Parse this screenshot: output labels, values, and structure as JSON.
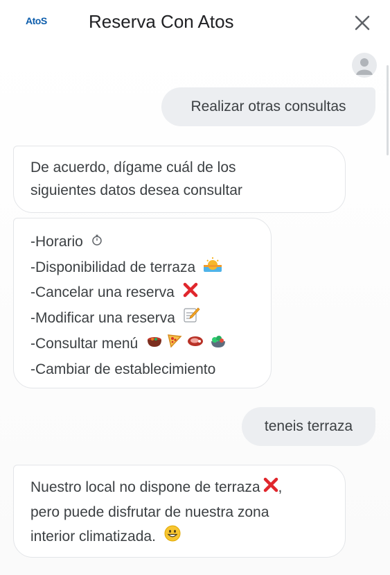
{
  "header": {
    "logo_text": "AtoS",
    "title": "Reserva Con Atos",
    "close_icon": "close-icon"
  },
  "chat": {
    "messages": [
      {
        "from": "user",
        "text": "Realizar otras consultas"
      },
      {
        "from": "bot",
        "lines": [
          "De acuerdo, dígame cuál de los",
          "siguientes datos desea consultar"
        ]
      },
      {
        "from": "bot",
        "lines": [
          "-Horario",
          "-Disponibilidad de terraza",
          "-Cancelar una reserva",
          "-Modificar una reserva",
          "-Consultar menú",
          "-Cambiar de establecimiento"
        ],
        "icons": [
          "stopwatch-icon",
          "sunrise-icon",
          "cross-mark-icon",
          "memo-icon",
          [
            "pot-of-food-icon",
            "pizza-icon",
            "meat-icon",
            "salad-icon"
          ]
        ]
      },
      {
        "from": "user",
        "text": "teneis terraza"
      },
      {
        "from": "bot",
        "lines": [
          "Nuestro local no dispone de terraza",
          "pero puede disfrutar de nuestra zona",
          "interior climatizada."
        ],
        "line_suffixes": [
          ",",
          "",
          ""
        ],
        "icons": [
          "cross-mark-icon",
          "grinning-face-icon"
        ]
      }
    ]
  },
  "colors": {
    "accent": "#0b5cab",
    "user_bubble": "#eceef1",
    "bot_border": "#e3e5e8",
    "cross": "#e0262c"
  }
}
